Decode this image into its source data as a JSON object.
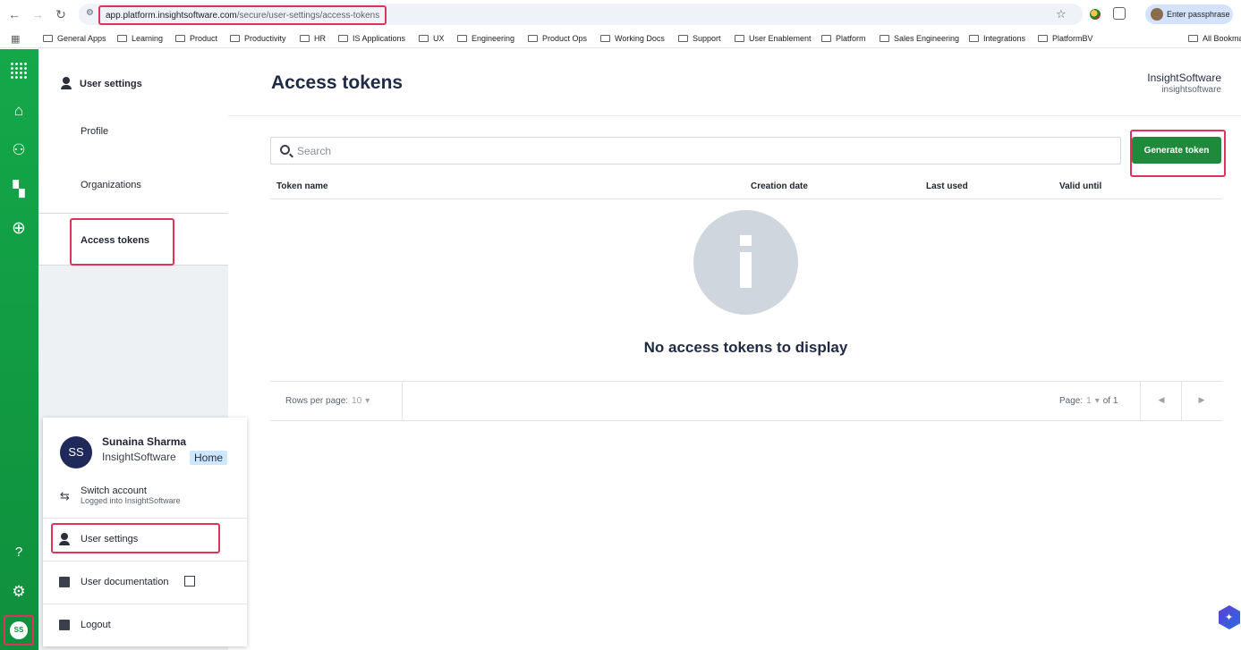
{
  "browser": {
    "url_host": "app.platform.insightsoftware.com",
    "url_path": "/secure/user-settings/access-tokens",
    "passphrase_button": "Enter passphrase",
    "bookmarks": [
      "General Apps",
      "Learning",
      "Product",
      "Productivity",
      "HR",
      "IS Applications",
      "UX",
      "Engineering",
      "Product Ops",
      "Working Docs",
      "Support",
      "User Enablement",
      "Platform",
      "Sales Engineering",
      "Integrations",
      "PlatformBV"
    ],
    "all_bookmarks": "All Bookma"
  },
  "rail": {
    "avatar_initials": "SS",
    "icons": [
      "apps-grid-icon",
      "home-icon",
      "people-icon",
      "dashboard-icon",
      "add-circle-icon",
      "help-icon",
      "settings-icon"
    ]
  },
  "settings_nav": {
    "header": "User settings",
    "items": [
      "Profile",
      "Organizations",
      "Access tokens"
    ],
    "active": "Access tokens"
  },
  "main": {
    "title": "Access tokens",
    "org_name": "InsightSoftware",
    "org_id": "insightsoftware",
    "search_placeholder": "Search",
    "generate_button": "Generate token",
    "columns": [
      "Token name",
      "Creation date",
      "Last used",
      "Valid until"
    ],
    "empty_message": "No access tokens to display",
    "rows_per_page_label": "Rows per page:",
    "rows_per_page_value": "10",
    "page_label": "Page:",
    "page_value": "1",
    "page_of": "of 1"
  },
  "user_menu": {
    "initials": "SS",
    "name": "Sunaina Sharma",
    "org": "InsightSoftware",
    "badge": "Home",
    "switch_account": "Switch account",
    "switch_sub": "Logged into InsightSoftware",
    "user_settings": "User settings",
    "user_documentation": "User documentation",
    "logout": "Logout"
  },
  "colors": {
    "rail_green": "#14a84a",
    "primary_button": "#1f8a3b",
    "highlight": "#e0335a",
    "title_navy": "#1f2a44"
  }
}
